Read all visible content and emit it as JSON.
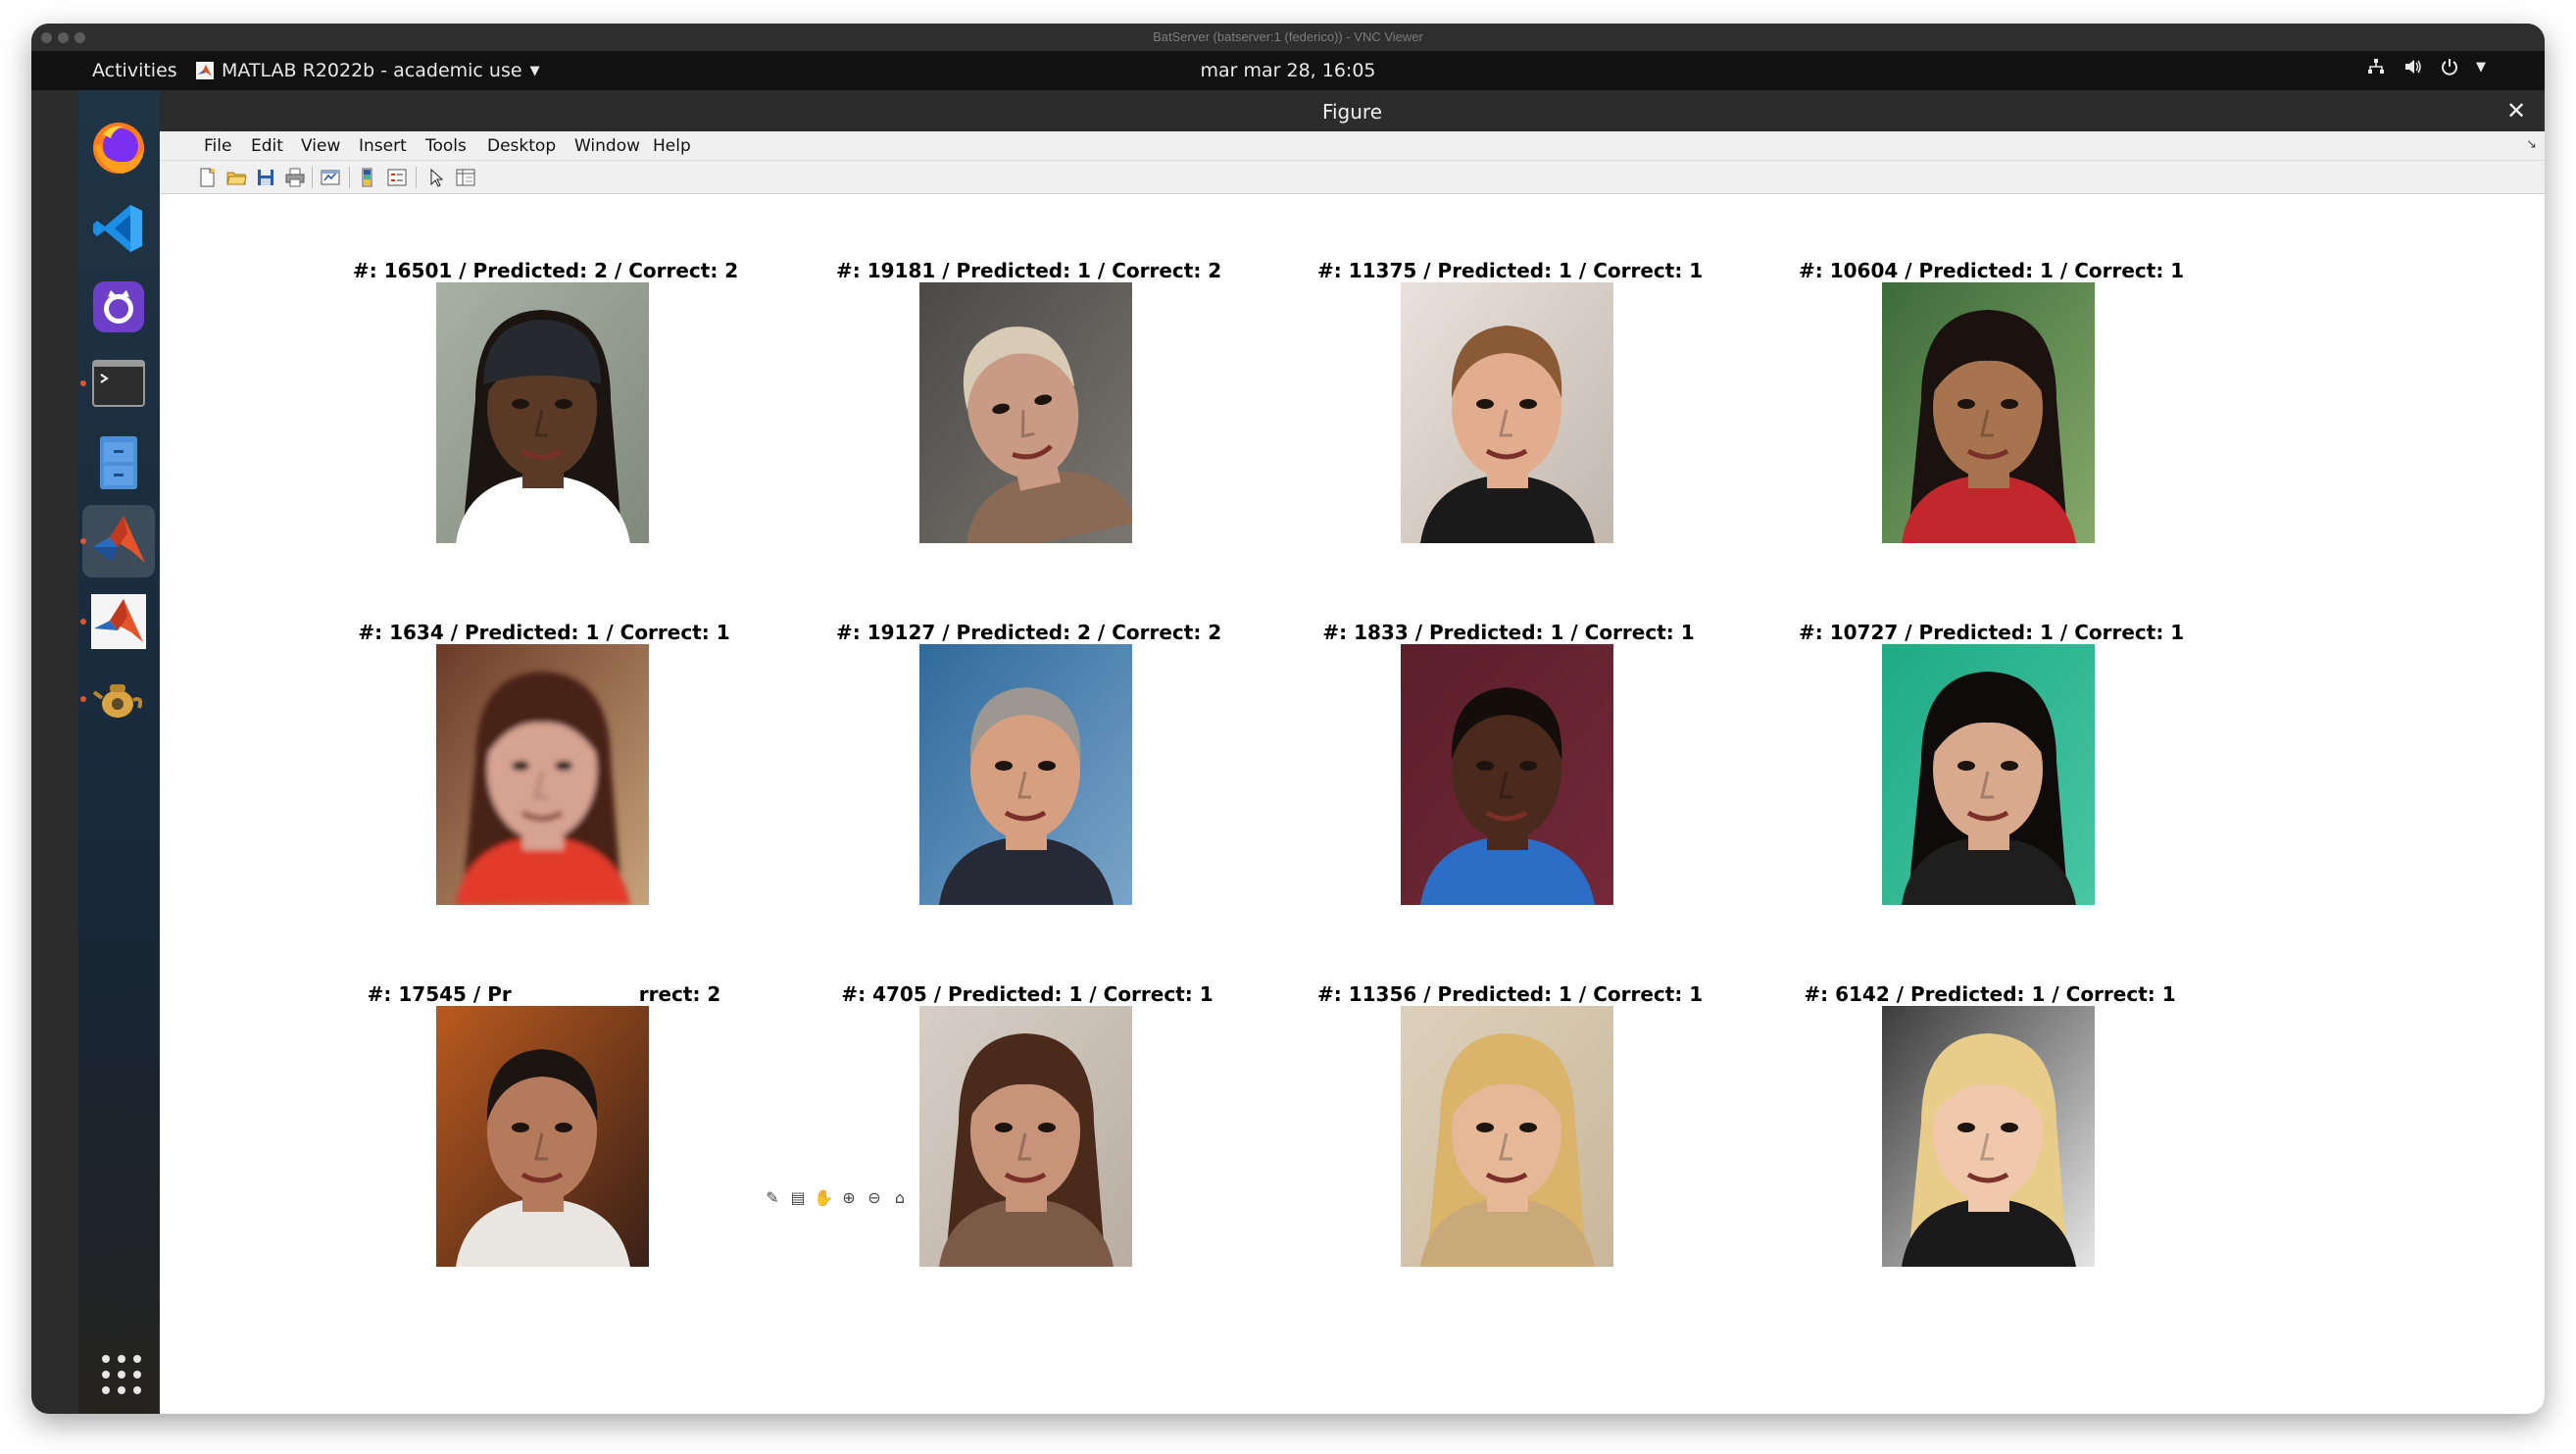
{
  "vnc": {
    "title": "BatServer (batserver:1 (federico)) - VNC Viewer"
  },
  "topbar": {
    "activities": "Activities",
    "app_menu": "MATLAB R2022b - academic use",
    "clock": "mar mar 28, 16:05"
  },
  "dock": {
    "items": [
      "firefox-icon",
      "vscode-icon",
      "github-desktop-icon",
      "terminal-icon",
      "file-cabinet-icon",
      "matlab-icon",
      "matlab-icon",
      "teapot-icon"
    ],
    "show_apps": "grid-icon"
  },
  "figure": {
    "title": "Figure",
    "menu": [
      "File",
      "Edit",
      "View",
      "Insert",
      "Tools",
      "Desktop",
      "Window",
      "Help"
    ],
    "panels": [
      {
        "title": "#: 16501 / Predicted: 2 / Correct: 2"
      },
      {
        "title": "#: 19181 / Predicted: 1 / Correct: 2"
      },
      {
        "title": "#: 11375 / Predicted: 1 / Correct: 1"
      },
      {
        "title": "#: 10604 / Predicted: 1 / Correct: 1"
      },
      {
        "title": "#: 1634 / Predicted: 1 / Correct: 1"
      },
      {
        "title": "#: 19127 / Predicted: 2 / Correct: 2"
      },
      {
        "title": "#: 1833 / Predicted: 1 / Correct: 1"
      },
      {
        "title": "#: 10727 / Predicted: 1 / Correct: 1"
      },
      {
        "title": "#: 17545 / Pr",
        "title_tail": "rrect: 2"
      },
      {
        "title": "#: 4705 / Predicted: 1 / Correct: 1"
      },
      {
        "title": "#: 11356 / Predicted: 1 / Correct: 1"
      },
      {
        "title": "#: 6142 / Predicted: 1 / Correct: 1"
      }
    ]
  },
  "colors": {
    "accent_orange": "#e3542a",
    "matlab_blue": "#2a5a9a"
  }
}
